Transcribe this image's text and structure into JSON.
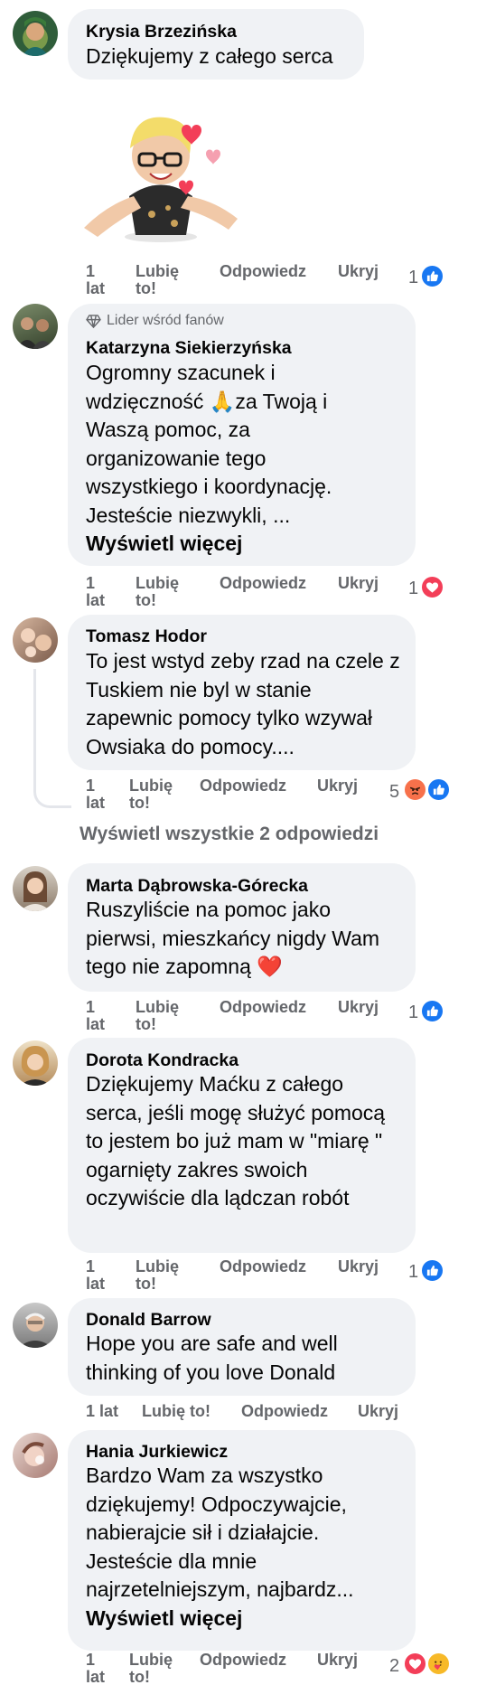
{
  "colors": {
    "like": "#1877f2",
    "love": "#f33e58",
    "angry": "#f7714b",
    "meta": "#65676b",
    "bubble": "#f0f2f5"
  },
  "comments": [
    {
      "author": "Krysia Brzezińska",
      "text": "Dziękujemy z całego serca",
      "sticker": "avatar-sticker-with-hearts",
      "time": "1 lat",
      "like_label": "Lubię to!",
      "reply_label": "Odpowiedz",
      "hide_label": "Ukryj",
      "reaction_count": "1",
      "reactions": [
        "like-icon"
      ]
    },
    {
      "badge": "Lider wśród fanów",
      "author": "Katarzyna Siekierzyńska",
      "text": "Ogromny szacunek i wdzięczność 🙏za Twoją i Waszą pomoc, za organizowanie tego wszystkiego i koordynację. Jesteście niezwykli, ...",
      "see_more": "Wyświetl więcej",
      "time": "1 lat",
      "like_label": "Lubię to!",
      "reply_label": "Odpowiedz",
      "hide_label": "Ukryj",
      "reaction_count": "1",
      "reactions": [
        "love-icon"
      ]
    },
    {
      "author": "Tomasz Hodor",
      "text": "To jest wstyd zeby rzad na czele z Tuskiem nie byl w stanie zapewnic pomocy tylko wzywał Owsiaka do pomocy....",
      "time": "1 lat",
      "like_label": "Lubię to!",
      "reply_label": "Odpowiedz",
      "hide_label": "Ukryj",
      "reaction_count": "5",
      "reactions": [
        "angry-icon",
        "like-icon"
      ],
      "view_replies": "Wyświetl wszystkie 2 odpowiedzi"
    },
    {
      "author": "Marta Dąbrowska-Górecka",
      "text": "Ruszyliście na pomoc jako pierwsi, mieszkańcy nigdy Wam tego nie zapomną ❤️",
      "time": "1 lat",
      "like_label": "Lubię to!",
      "reply_label": "Odpowiedz",
      "hide_label": "Ukryj",
      "reaction_count": "1",
      "reactions": [
        "like-icon"
      ]
    },
    {
      "author": "Dorota Kondracka",
      "text": "Dziękujemy Maćku z całego serca, jeśli mogę służyć pomocą to jestem bo już mam w \"miarę \" ogarnięty zakres swoich oczywiście dla lądczan robót",
      "time": "1 lat",
      "like_label": "Lubię to!",
      "reply_label": "Odpowiedz",
      "hide_label": "Ukryj",
      "reaction_count": "1",
      "reactions": [
        "like-icon"
      ]
    },
    {
      "author": "Donald Barrow",
      "text": "Hope you are safe and well thinking of you love Donald",
      "time": "1 lat",
      "like_label": "Lubię to!",
      "reply_label": "Odpowiedz",
      "hide_label": "Ukryj"
    },
    {
      "author": "Hania Jurkiewicz",
      "text": "Bardzo Wam za wszystko dziękujemy! Odpoczywajcie, nabierajcie sił i działajcie. Jesteście dla mnie najrzetelniejszym, najbardz...",
      "see_more": "Wyświetl więcej",
      "time": "1 lat",
      "like_label": "Lubię to!",
      "reply_label": "Odpowiedz",
      "hide_label": "Ukryj",
      "reaction_count": "2",
      "reactions": [
        "love-icon",
        "care-icon"
      ]
    }
  ]
}
